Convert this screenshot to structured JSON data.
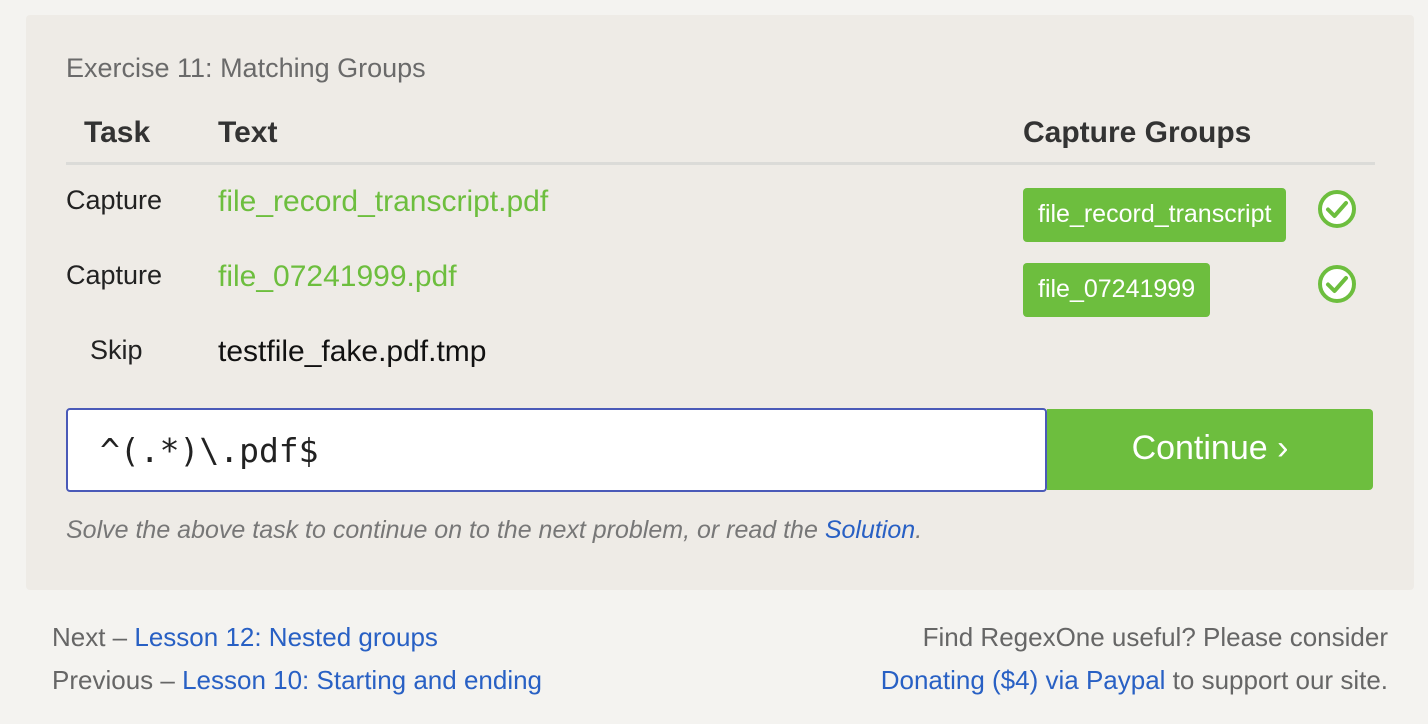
{
  "exercise": {
    "title": "Exercise 11: Matching Groups",
    "headers": {
      "task": "Task",
      "text": "Text",
      "capture_groups": "Capture Groups"
    },
    "rows": [
      {
        "task": "Capture",
        "text": "file_record_transcript.pdf",
        "group": "file_record_transcript",
        "status": "pass"
      },
      {
        "task": "Capture",
        "text": "file_07241999.pdf",
        "group": "file_07241999",
        "status": "pass"
      },
      {
        "task": "Skip",
        "text": "testfile_fake.pdf.tmp",
        "status": "skip"
      }
    ],
    "input": {
      "value": "^(.*)\\.pdf$"
    },
    "continue_label": "Continue ›",
    "hint": {
      "before": "Solve the above task to continue on to the next problem, or read the ",
      "link": "Solution",
      "after": "."
    }
  },
  "footer": {
    "next": {
      "prefix": "Next – ",
      "link": "Lesson 12: Nested groups"
    },
    "previous": {
      "prefix": "Previous – ",
      "link": "Lesson 10: Starting and ending"
    },
    "donate": {
      "line1": "Find RegexOne useful? Please consider",
      "link": "Donating ($4) via Paypal",
      "suffix": " to support our site."
    }
  },
  "colors": {
    "success": "#6dbe3e",
    "link": "#2860c4",
    "input_border": "#4a5ab8"
  },
  "icons": {
    "row_status": "check-circle-icon"
  }
}
